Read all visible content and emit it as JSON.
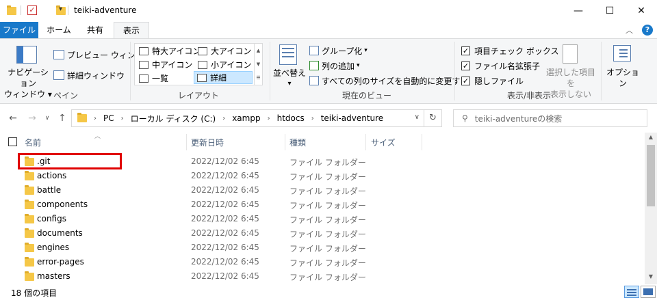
{
  "window": {
    "title": "teiki-adventure",
    "minimize_icon": "—",
    "maximize_icon": "☐",
    "close_icon": "✕"
  },
  "tabs": [
    {
      "label": "ファイル"
    },
    {
      "label": "ホーム"
    },
    {
      "label": "共有"
    },
    {
      "label": "表示"
    }
  ],
  "ribbon": {
    "pane": {
      "nav_pane_line1": "ナビゲーション",
      "nav_pane_line2": "ウィンドウ",
      "preview_pane": "プレビュー ウィンドウ",
      "details_pane": "詳細ウィンドウ",
      "group_label": "ペイン"
    },
    "layout": {
      "items": [
        "特大アイコン",
        "大アイコン",
        "中アイコン",
        "小アイコン",
        "一覧",
        "詳細"
      ],
      "group_label": "レイアウト"
    },
    "current_view": {
      "sort_by": "並べ替え",
      "group_by": "グループ化",
      "add_columns": "列の追加",
      "autosize": "すべての列のサイズを自動的に変更する",
      "group_label": "現在のビュー"
    },
    "show_hide": {
      "item_checkboxes": "項目チェック ボックス",
      "file_extensions": "ファイル名拡張子",
      "hidden_items": "隠しファイル",
      "hide_selected_line1": "選択した項目を",
      "hide_selected_line2": "表示しない",
      "group_label": "表示/非表示"
    },
    "options": "オプション"
  },
  "address": {
    "crumbs": [
      "PC",
      "ローカル ディスク (C:)",
      "xampp",
      "htdocs",
      "teiki-adventure"
    ],
    "search_placeholder": "teiki-adventureの検索"
  },
  "columns": {
    "name": "名前",
    "date": "更新日時",
    "type": "種類",
    "size": "サイズ"
  },
  "files": [
    {
      "name": ".git",
      "date": "2022/12/02 6:45",
      "type": "ファイル フォルダー"
    },
    {
      "name": "actions",
      "date": "2022/12/02 6:45",
      "type": "ファイル フォルダー"
    },
    {
      "name": "battle",
      "date": "2022/12/02 6:45",
      "type": "ファイル フォルダー"
    },
    {
      "name": "components",
      "date": "2022/12/02 6:45",
      "type": "ファイル フォルダー"
    },
    {
      "name": "configs",
      "date": "2022/12/02 6:45",
      "type": "ファイル フォルダー"
    },
    {
      "name": "documents",
      "date": "2022/12/02 6:45",
      "type": "ファイル フォルダー"
    },
    {
      "name": "engines",
      "date": "2022/12/02 6:45",
      "type": "ファイル フォルダー"
    },
    {
      "name": "error-pages",
      "date": "2022/12/02 6:45",
      "type": "ファイル フォルダー"
    },
    {
      "name": "masters",
      "date": "2022/12/02 6:45",
      "type": "ファイル フォルダー"
    }
  ],
  "status": {
    "count": "18 個の項目"
  },
  "colors": {
    "accent": "#1979ca",
    "highlight": "#e00000",
    "folder": "#f5c747"
  }
}
